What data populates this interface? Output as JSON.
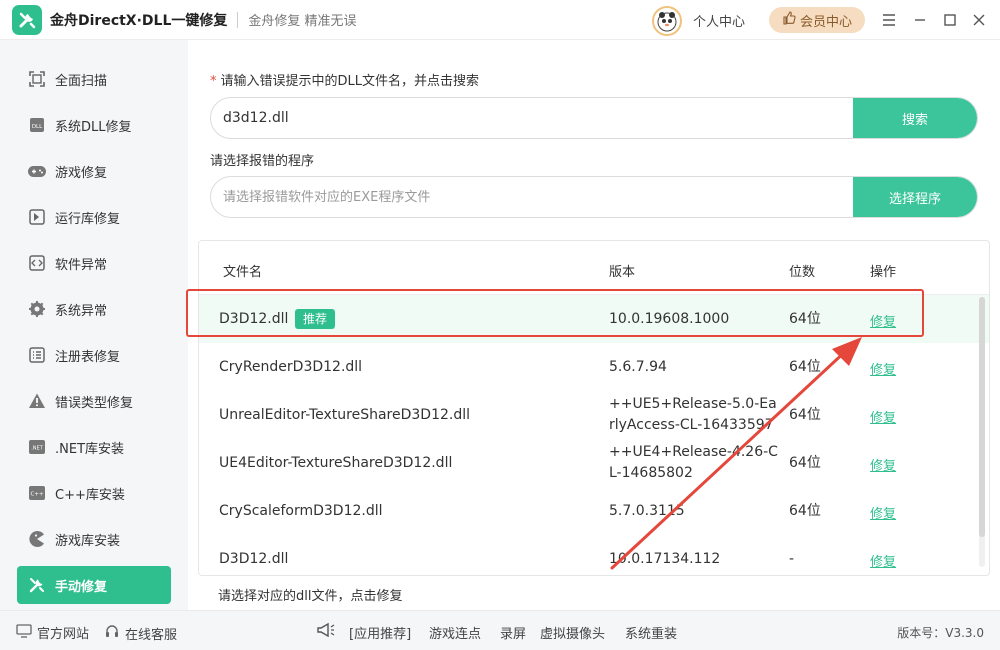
{
  "app": {
    "title": "金舟DirectX·DLL一键修复",
    "slogan": "金舟修复 精准无误",
    "user_center": "个人中心",
    "vip_label": "会员中心"
  },
  "sidebar": {
    "items": [
      {
        "label": "全面扫描",
        "icon": "scan-icon"
      },
      {
        "label": "系统DLL修复",
        "icon": "dll-icon"
      },
      {
        "label": "游戏修复",
        "icon": "gamepad-icon"
      },
      {
        "label": "运行库修复",
        "icon": "runtime-icon"
      },
      {
        "label": "软件异常",
        "icon": "code-icon"
      },
      {
        "label": "系统异常",
        "icon": "gear-icon"
      },
      {
        "label": "注册表修复",
        "icon": "registry-icon"
      },
      {
        "label": "错误类型修复",
        "icon": "warning-icon"
      },
      {
        "label": ".NET库安装",
        "icon": "dotnet-icon"
      },
      {
        "label": "C++库安装",
        "icon": "cpp-icon"
      },
      {
        "label": "游戏库安装",
        "icon": "pacman-icon"
      },
      {
        "label": "手动修复",
        "icon": "tools-icon",
        "active": true
      }
    ]
  },
  "search": {
    "label": "请输入错误提示中的DLL文件名，并点击搜索",
    "required_mark": "*",
    "value": "d3d12.dll",
    "button": "搜索"
  },
  "program": {
    "label": "请选择报错的程序",
    "placeholder": "请选择报错软件对应的EXE程序文件",
    "button": "选择程序"
  },
  "table": {
    "headers": {
      "name": "文件名",
      "version": "版本",
      "bits": "位数",
      "action": "操作"
    },
    "recommend_badge": "推荐",
    "action_label": "修复",
    "rows": [
      {
        "name": "D3D12.dll",
        "version": "10.0.19608.1000",
        "bits": "64位",
        "recommended": true
      },
      {
        "name": "CryRenderD3D12.dll",
        "version": "5.6.7.94",
        "bits": "64位"
      },
      {
        "name": "UnrealEditor-TextureShareD3D12.dll",
        "version_line1": "++UE5+Release-5.0-Ea",
        "version_line2": "rlyAccess-CL-16433597",
        "bits": "64位"
      },
      {
        "name": "UE4Editor-TextureShareD3D12.dll",
        "version_line1": "++UE4+Release-4.26-C",
        "version_line2": "L-14685802",
        "bits": "64位"
      },
      {
        "name": "CryScaleformD3D12.dll",
        "version": "5.7.0.3115",
        "bits": "64位"
      },
      {
        "name": "D3D12.dll",
        "version": "10.0.17134.112",
        "bits": "-"
      }
    ]
  },
  "hint": "请选择对应的dll文件，点击修复",
  "footer": {
    "official_site": "官方网站",
    "online_service": "在线客服",
    "links": [
      "[应用推荐]",
      "游戏连点",
      "录屏",
      "虚拟摄像头",
      "系统重装"
    ],
    "version": "版本号：V3.3.0"
  },
  "colors": {
    "accent": "#2fbf8f",
    "highlight_box": "#e5473a"
  }
}
